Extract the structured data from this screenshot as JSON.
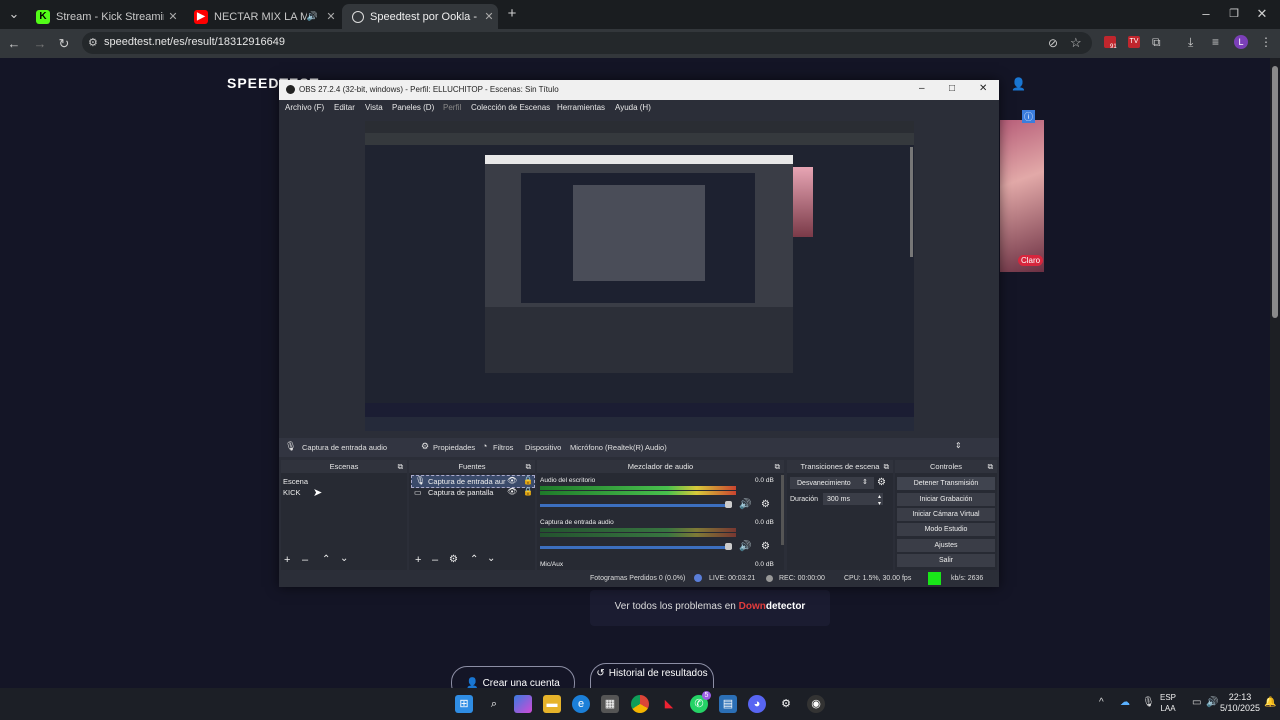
{
  "browser": {
    "tabs": [
      {
        "title": "Stream - Kick Streaming",
        "icon": "kick-icon",
        "active": false
      },
      {
        "title": "NECTAR MIX LA MEJOR CU",
        "icon": "youtube-icon",
        "active": false
      },
      {
        "title": "Speedtest por Ookla - La prueb",
        "icon": "speedtest-icon",
        "active": true
      }
    ],
    "url": "speedtest.net/es/result/18312916649",
    "profile_initial": "L",
    "extension_badge": "91"
  },
  "page": {
    "logo": "SPEEDTEST",
    "downdetector_prefix": "Ver todos los problemas en",
    "downdetector_brand_a": "Down",
    "downdetector_brand_b": "detector",
    "create_account": "Crear una cuenta",
    "history": "Historial de resultados",
    "ad_label": "Claro"
  },
  "obs": {
    "title": "OBS 27.2.4 (32-bit, windows) - Perfil: ELLUCHITOP - Escenas: Sin Título",
    "menu": [
      "Archivo (F)",
      "Editar",
      "Vista",
      "Paneles (D)",
      "Perfil",
      "Colección de Escenas",
      "Herramientas",
      "Ayuda (H)"
    ],
    "source_bar": {
      "source_name": "Captura de entrada audio",
      "properties": "Propiedades",
      "filters": "Filtros",
      "device_label": "Dispositivo",
      "device_value": "Micrófono (Realtek(R) Audio)"
    },
    "docks": {
      "scenes": {
        "title": "Escenas",
        "items": [
          "Escena",
          "KICK"
        ]
      },
      "sources": {
        "title": "Fuentes",
        "items": [
          "Captura de entrada aur",
          "Captura de pantalla"
        ]
      },
      "mixer": {
        "title": "Mezclador de audio",
        "channels": [
          {
            "name": "Audio del escritorio",
            "db": "0.0 dB"
          },
          {
            "name": "Captura de entrada audio",
            "db": "0.0 dB"
          },
          {
            "name": "Mic/Aux",
            "db": "0.0 dB"
          }
        ]
      },
      "transitions": {
        "title": "Transiciones de escena",
        "transition": "Desvanecimiento",
        "duration_label": "Duración",
        "duration_value": "300 ms"
      },
      "controls": {
        "title": "Controles",
        "buttons": [
          "Detener Transmisión",
          "Iniciar Grabación",
          "Iniciar Cámara Virtual",
          "Modo Estudio",
          "Ajustes",
          "Salir"
        ]
      }
    },
    "status": {
      "dropped": "Fotogramas Perdidos 0 (0.0%)",
      "live": "LIVE: 00:03:21",
      "rec": "REC: 00:00:00",
      "cpu": "CPU: 1.5%, 30.00 fps",
      "kbps": "kb/s: 2636"
    }
  },
  "taskbar": {
    "lang_top": "ESP",
    "lang_bottom": "LAA",
    "time": "22:13",
    "date": "5/10/2025",
    "whatsapp_badge": "5"
  },
  "colors": {
    "accent_green": "#53fc18",
    "youtube_red": "#ff0000",
    "live_green": "#19e619"
  }
}
